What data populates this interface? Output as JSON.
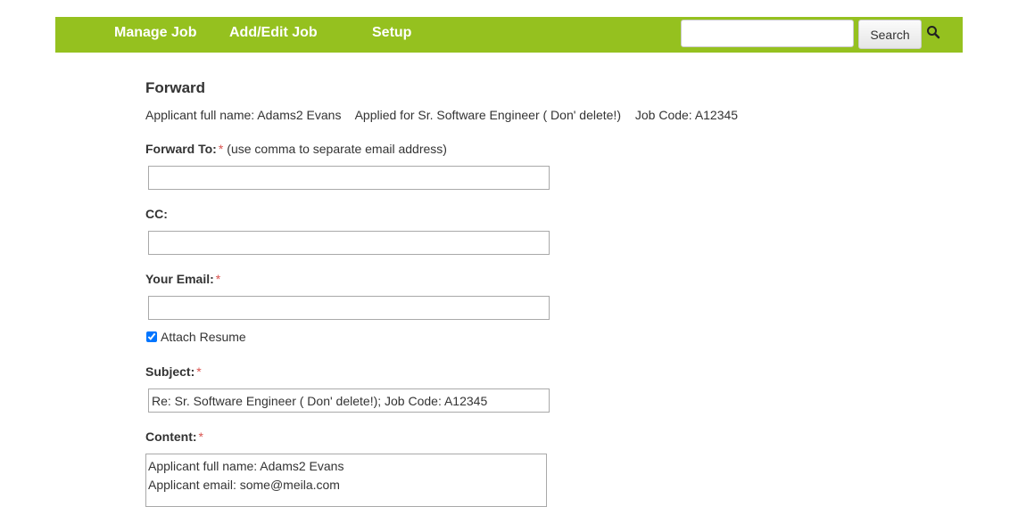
{
  "nav": {
    "items": [
      {
        "label": "Manage Job"
      },
      {
        "label": "Add/Edit Job"
      },
      {
        "label": "Setup"
      }
    ],
    "search": {
      "placeholder": "",
      "value": "",
      "button_label": "Search"
    },
    "color": "#95c11f"
  },
  "page": {
    "title": "Forward",
    "info": {
      "applicant": "Applicant full name: Adams2 Evans",
      "applied_for": "Applied for Sr. Software Engineer ( Don' delete!)",
      "job_code": "Job Code: A12345"
    }
  },
  "form": {
    "forward_to": {
      "label": "Forward To:",
      "required_mark": "*",
      "hint": "(use comma to separate email address)",
      "value": ""
    },
    "cc": {
      "label": "CC:",
      "value": ""
    },
    "your_email": {
      "label": "Your Email:",
      "required_mark": "*",
      "value": ""
    },
    "attach_resume": {
      "label": "Attach Resume",
      "checked": true
    },
    "subject": {
      "label": "Subject:",
      "required_mark": "*",
      "value": "Re: Sr. Software Engineer ( Don' delete!); Job Code: A12345"
    },
    "content": {
      "label": "Content:",
      "required_mark": "*",
      "value": "Applicant full name: Adams2 Evans\nApplicant email: some@meila.com"
    }
  }
}
